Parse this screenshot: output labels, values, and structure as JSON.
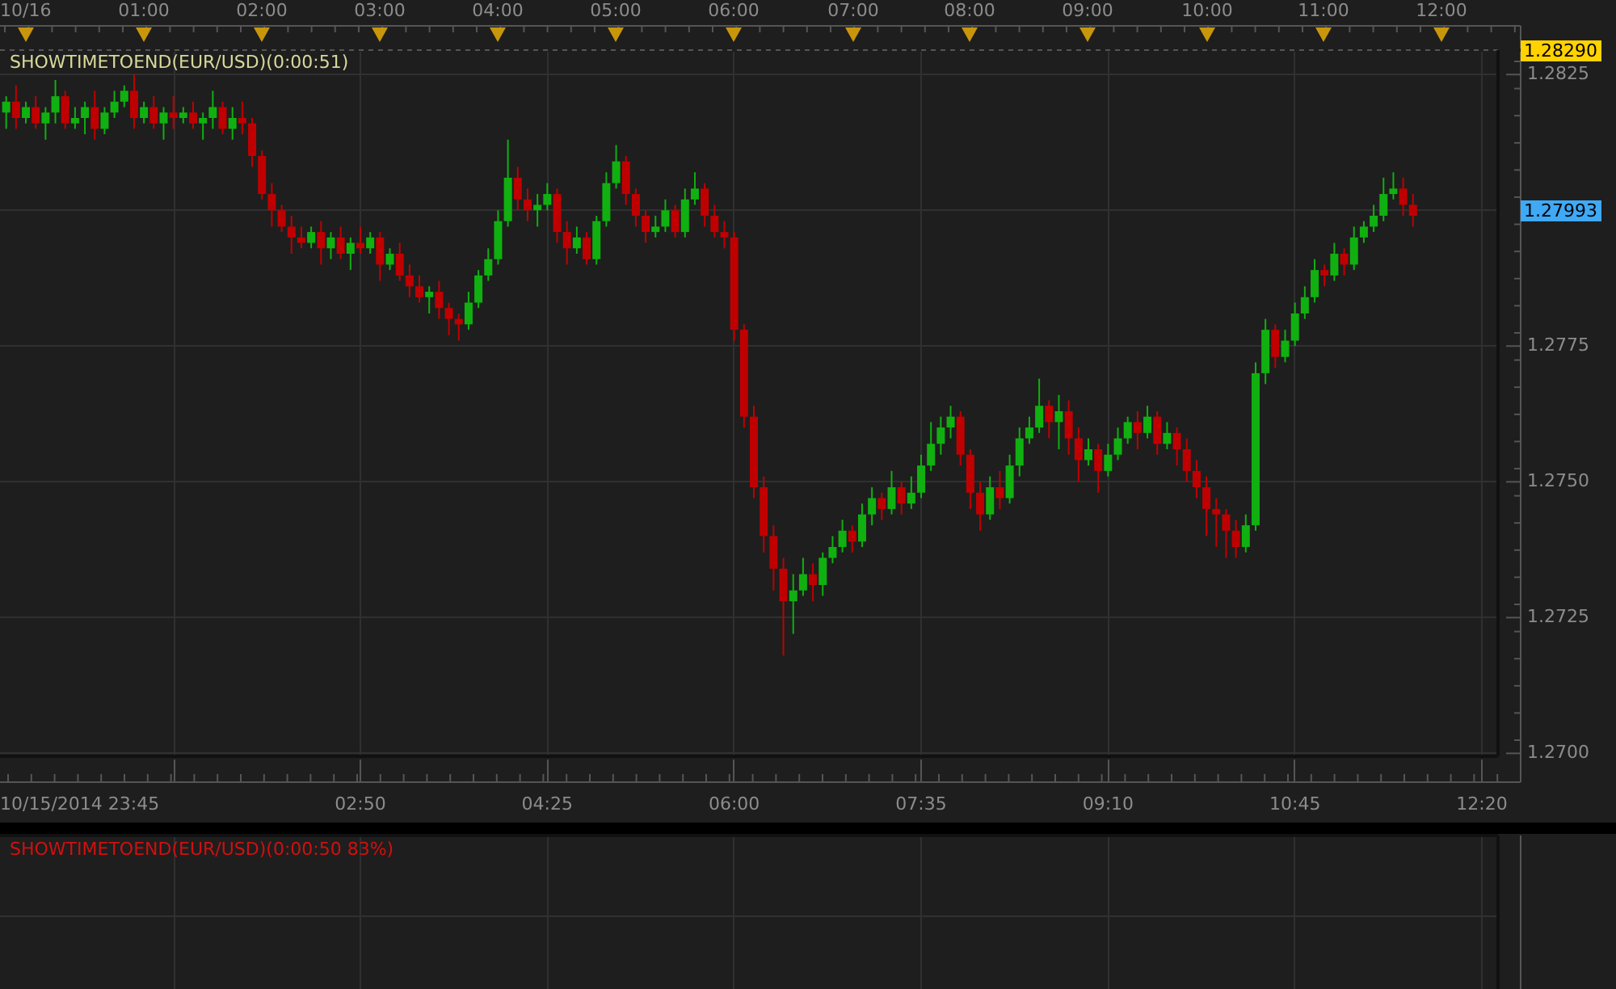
{
  "top_axis": {
    "labels": [
      "10/16",
      "01:00",
      "02:00",
      "03:00",
      "04:00",
      "05:00",
      "06:00",
      "07:00",
      "08:00",
      "09:00",
      "10:00",
      "11:00",
      "12:00"
    ]
  },
  "main_panel": {
    "indicator_label": "SHOWTIMETOEND(EUR/USD)(0:00:51)",
    "chart_data": {
      "type": "candlestick",
      "ylim": [
        1.26947,
        1.28292
      ],
      "xlim": [
        -13.15,
        759.7
      ],
      "xticks": [
        {
          "value": 170,
          "label": "02:50"
        },
        {
          "value": 265,
          "label": "04:25"
        },
        {
          "value": 360,
          "label": "06:00"
        },
        {
          "value": 455,
          "label": "07:35"
        },
        {
          "value": 550,
          "label": "09:10"
        },
        {
          "value": 645,
          "label": "10:45"
        },
        {
          "value": 740,
          "label": "12:20"
        }
      ],
      "yticks": [
        {
          "value": 1.2825,
          "label": "1.2825"
        },
        {
          "value": 1.2775,
          "label": "1.2775"
        },
        {
          "value": 1.275,
          "label": "1.2750"
        },
        {
          "value": 1.2725,
          "label": "1.2725"
        },
        {
          "value": 1.27,
          "label": "1.2700"
        }
      ],
      "x": [
        -10,
        -5,
        0,
        5,
        10,
        15,
        20,
        25,
        30,
        35,
        40,
        45,
        50,
        55,
        60,
        65,
        70,
        75,
        80,
        85,
        90,
        95,
        100,
        105,
        110,
        115,
        120,
        125,
        130,
        135,
        140,
        145,
        150,
        155,
        160,
        165,
        170,
        175,
        180,
        185,
        190,
        195,
        200,
        205,
        210,
        215,
        220,
        225,
        230,
        235,
        240,
        245,
        250,
        255,
        260,
        265,
        270,
        275,
        280,
        285,
        290,
        295,
        300,
        305,
        310,
        315,
        320,
        325,
        330,
        335,
        340,
        345,
        350,
        355,
        360,
        365,
        370,
        375,
        380,
        385,
        390,
        395,
        400,
        405,
        410,
        415,
        420,
        425,
        430,
        435,
        440,
        445,
        450,
        455,
        460,
        465,
        470,
        475,
        480,
        485,
        490,
        495,
        500,
        505,
        510,
        515,
        520,
        525,
        530,
        535,
        540,
        545,
        550,
        555,
        560,
        565,
        570,
        575,
        580,
        585,
        590,
        595,
        600,
        605,
        610,
        615,
        620,
        625,
        630,
        635,
        640,
        645,
        650,
        655,
        660,
        665,
        670,
        675,
        680,
        685,
        690,
        695,
        700,
        705
      ],
      "ohlc": [
        [
          1.2818,
          1.2821,
          1.2815,
          1.282
        ],
        [
          1.282,
          1.2823,
          1.2815,
          1.2817
        ],
        [
          1.2817,
          1.282,
          1.2816,
          1.2819
        ],
        [
          1.2819,
          1.2821,
          1.2815,
          1.2816
        ],
        [
          1.2816,
          1.2819,
          1.2813,
          1.2818
        ],
        [
          1.2818,
          1.2824,
          1.2816,
          1.2821
        ],
        [
          1.2821,
          1.2822,
          1.2815,
          1.2816
        ],
        [
          1.2816,
          1.2819,
          1.2815,
          1.2817
        ],
        [
          1.2817,
          1.282,
          1.2814,
          1.2819
        ],
        [
          1.2819,
          1.2822,
          1.2813,
          1.2815
        ],
        [
          1.2815,
          1.2819,
          1.2814,
          1.2818
        ],
        [
          1.2818,
          1.2822,
          1.2817,
          1.282
        ],
        [
          1.282,
          1.2823,
          1.2819,
          1.2822
        ],
        [
          1.2822,
          1.2825,
          1.2815,
          1.2817
        ],
        [
          1.2817,
          1.282,
          1.2816,
          1.2819
        ],
        [
          1.2819,
          1.2821,
          1.2815,
          1.2816
        ],
        [
          1.2816,
          1.2819,
          1.2813,
          1.2818
        ],
        [
          1.2818,
          1.2821,
          1.2815,
          1.2817
        ],
        [
          1.2817,
          1.2819,
          1.2816,
          1.2818
        ],
        [
          1.2818,
          1.282,
          1.2815,
          1.2816
        ],
        [
          1.2816,
          1.2818,
          1.2813,
          1.2817
        ],
        [
          1.2817,
          1.2822,
          1.2815,
          1.2819
        ],
        [
          1.2819,
          1.282,
          1.2814,
          1.2815
        ],
        [
          1.2815,
          1.2819,
          1.2813,
          1.2817
        ],
        [
          1.2817,
          1.282,
          1.2814,
          1.2816
        ],
        [
          1.2816,
          1.2817,
          1.2808,
          1.281
        ],
        [
          1.281,
          1.2811,
          1.2802,
          1.2803
        ],
        [
          1.2803,
          1.2805,
          1.2797,
          1.28
        ],
        [
          1.28,
          1.2801,
          1.2796,
          1.2797
        ],
        [
          1.2797,
          1.2799,
          1.2792,
          1.2795
        ],
        [
          1.2795,
          1.2797,
          1.2793,
          1.2794
        ],
        [
          1.2794,
          1.2797,
          1.2793,
          1.2796
        ],
        [
          1.2796,
          1.2798,
          1.279,
          1.2793
        ],
        [
          1.2793,
          1.2796,
          1.2791,
          1.2795
        ],
        [
          1.2795,
          1.2797,
          1.2791,
          1.2792
        ],
        [
          1.2792,
          1.2795,
          1.2789,
          1.2794
        ],
        [
          1.2794,
          1.2797,
          1.2792,
          1.2793
        ],
        [
          1.2793,
          1.2796,
          1.2792,
          1.2795
        ],
        [
          1.2795,
          1.2796,
          1.2787,
          1.279
        ],
        [
          1.279,
          1.2793,
          1.2789,
          1.2792
        ],
        [
          1.2792,
          1.2794,
          1.2787,
          1.2788
        ],
        [
          1.2788,
          1.279,
          1.2784,
          1.2786
        ],
        [
          1.2786,
          1.2788,
          1.2783,
          1.2784
        ],
        [
          1.2784,
          1.2786,
          1.2781,
          1.2785
        ],
        [
          1.2785,
          1.2787,
          1.278,
          1.2782
        ],
        [
          1.2782,
          1.2783,
          1.2777,
          1.278
        ],
        [
          1.278,
          1.2781,
          1.2776,
          1.2779
        ],
        [
          1.2779,
          1.2785,
          1.2778,
          1.2783
        ],
        [
          1.2783,
          1.2789,
          1.2782,
          1.2788
        ],
        [
          1.2788,
          1.2793,
          1.2787,
          1.2791
        ],
        [
          1.2791,
          1.28,
          1.279,
          1.2798
        ],
        [
          1.2798,
          1.2813,
          1.2797,
          1.2806
        ],
        [
          1.2806,
          1.2808,
          1.28,
          1.2802
        ],
        [
          1.2802,
          1.2804,
          1.2798,
          1.28
        ],
        [
          1.28,
          1.2803,
          1.2797,
          1.2801
        ],
        [
          1.2801,
          1.2805,
          1.28,
          1.2803
        ],
        [
          1.2803,
          1.2804,
          1.2794,
          1.2796
        ],
        [
          1.2796,
          1.2798,
          1.279,
          1.2793
        ],
        [
          1.2793,
          1.2797,
          1.2792,
          1.2795
        ],
        [
          1.2795,
          1.2796,
          1.279,
          1.2791
        ],
        [
          1.2791,
          1.2799,
          1.279,
          1.2798
        ],
        [
          1.2798,
          1.2807,
          1.2797,
          1.2805
        ],
        [
          1.2805,
          1.2812,
          1.2804,
          1.2809
        ],
        [
          1.2809,
          1.281,
          1.2801,
          1.2803
        ],
        [
          1.2803,
          1.2804,
          1.2797,
          1.2799
        ],
        [
          1.2799,
          1.28,
          1.2794,
          1.2796
        ],
        [
          1.2796,
          1.2799,
          1.2795,
          1.2797
        ],
        [
          1.2797,
          1.2802,
          1.2796,
          1.28
        ],
        [
          1.28,
          1.2801,
          1.2795,
          1.2796
        ],
        [
          1.2796,
          1.2804,
          1.2795,
          1.2802
        ],
        [
          1.2802,
          1.2807,
          1.2801,
          1.2804
        ],
        [
          1.2804,
          1.2805,
          1.2797,
          1.2799
        ],
        [
          1.2799,
          1.2801,
          1.2795,
          1.2796
        ],
        [
          1.2796,
          1.2798,
          1.2793,
          1.2795
        ],
        [
          1.2795,
          1.2796,
          1.2776,
          1.2778
        ],
        [
          1.2778,
          1.2779,
          1.276,
          1.2762
        ],
        [
          1.2762,
          1.2764,
          1.2747,
          1.2749
        ],
        [
          1.2749,
          1.2751,
          1.2737,
          1.274
        ],
        [
          1.274,
          1.2742,
          1.273,
          1.2734
        ],
        [
          1.2734,
          1.2736,
          1.2718,
          1.2728
        ],
        [
          1.2728,
          1.2733,
          1.2722,
          1.273
        ],
        [
          1.273,
          1.2736,
          1.2729,
          1.2733
        ],
        [
          1.2733,
          1.2735,
          1.2728,
          1.2731
        ],
        [
          1.2731,
          1.2737,
          1.2729,
          1.2736
        ],
        [
          1.2736,
          1.274,
          1.2735,
          1.2738
        ],
        [
          1.2738,
          1.2743,
          1.2737,
          1.2741
        ],
        [
          1.2741,
          1.2742,
          1.2737,
          1.2739
        ],
        [
          1.2739,
          1.2746,
          1.2738,
          1.2744
        ],
        [
          1.2744,
          1.2749,
          1.2742,
          1.2747
        ],
        [
          1.2747,
          1.2748,
          1.2743,
          1.2745
        ],
        [
          1.2745,
          1.2752,
          1.2744,
          1.2749
        ],
        [
          1.2749,
          1.275,
          1.2744,
          1.2746
        ],
        [
          1.2746,
          1.2751,
          1.2745,
          1.2748
        ],
        [
          1.2748,
          1.2755,
          1.2747,
          1.2753
        ],
        [
          1.2753,
          1.2761,
          1.2752,
          1.2757
        ],
        [
          1.2757,
          1.2762,
          1.2755,
          1.276
        ],
        [
          1.276,
          1.2764,
          1.2758,
          1.2762
        ],
        [
          1.2762,
          1.2763,
          1.2753,
          1.2755
        ],
        [
          1.2755,
          1.2756,
          1.2745,
          1.2748
        ],
        [
          1.2748,
          1.275,
          1.2741,
          1.2744
        ],
        [
          1.2744,
          1.2751,
          1.2743,
          1.2749
        ],
        [
          1.2749,
          1.2752,
          1.2745,
          1.2747
        ],
        [
          1.2747,
          1.2755,
          1.2746,
          1.2753
        ],
        [
          1.2753,
          1.276,
          1.2751,
          1.2758
        ],
        [
          1.2758,
          1.2762,
          1.2757,
          1.276
        ],
        [
          1.276,
          1.2769,
          1.2759,
          1.2764
        ],
        [
          1.2764,
          1.2765,
          1.2758,
          1.2761
        ],
        [
          1.2761,
          1.2766,
          1.2756,
          1.2763
        ],
        [
          1.2763,
          1.2765,
          1.2755,
          1.2758
        ],
        [
          1.2758,
          1.276,
          1.275,
          1.2754
        ],
        [
          1.2754,
          1.2758,
          1.2753,
          1.2756
        ],
        [
          1.2756,
          1.2757,
          1.2748,
          1.2752
        ],
        [
          1.2752,
          1.2757,
          1.2751,
          1.2755
        ],
        [
          1.2755,
          1.276,
          1.2754,
          1.2758
        ],
        [
          1.2758,
          1.2762,
          1.2757,
          1.2761
        ],
        [
          1.2761,
          1.2763,
          1.2756,
          1.2759
        ],
        [
          1.2759,
          1.2764,
          1.2758,
          1.2762
        ],
        [
          1.2762,
          1.2763,
          1.2755,
          1.2757
        ],
        [
          1.2757,
          1.2761,
          1.2756,
          1.2759
        ],
        [
          1.2759,
          1.276,
          1.2753,
          1.2756
        ],
        [
          1.2756,
          1.2758,
          1.275,
          1.2752
        ],
        [
          1.2752,
          1.2754,
          1.2747,
          1.2749
        ],
        [
          1.2749,
          1.2751,
          1.274,
          1.2745
        ],
        [
          1.2745,
          1.2747,
          1.2738,
          1.2744
        ],
        [
          1.2744,
          1.2745,
          1.2736,
          1.2741
        ],
        [
          1.2741,
          1.2743,
          1.2736,
          1.2738
        ],
        [
          1.2738,
          1.2744,
          1.2737,
          1.2742
        ],
        [
          1.2742,
          1.2772,
          1.2741,
          1.277
        ],
        [
          1.277,
          1.278,
          1.2768,
          1.2778
        ],
        [
          1.2778,
          1.2779,
          1.2771,
          1.2773
        ],
        [
          1.2773,
          1.2778,
          1.2772,
          1.2776
        ],
        [
          1.2776,
          1.2783,
          1.2775,
          1.2781
        ],
        [
          1.2781,
          1.2786,
          1.278,
          1.2784
        ],
        [
          1.2784,
          1.2791,
          1.2783,
          1.2789
        ],
        [
          1.2789,
          1.279,
          1.2786,
          1.2788
        ],
        [
          1.2788,
          1.2794,
          1.2787,
          1.2792
        ],
        [
          1.2792,
          1.2793,
          1.2788,
          1.279
        ],
        [
          1.279,
          1.2797,
          1.2789,
          1.2795
        ],
        [
          1.2795,
          1.2798,
          1.2794,
          1.2797
        ],
        [
          1.2797,
          1.2801,
          1.2796,
          1.2799
        ],
        [
          1.2799,
          1.2806,
          1.2798,
          1.2803
        ],
        [
          1.2803,
          1.2807,
          1.2802,
          1.2804
        ],
        [
          1.2804,
          1.2806,
          1.2799,
          1.2801
        ],
        [
          1.2801,
          1.2803,
          1.2797,
          1.2799
        ]
      ]
    }
  },
  "price_axis": {
    "high_price": "1.28290",
    "last_price": "1.27993"
  },
  "bottom_axis": {
    "start_label": "10/15/2014 23:45"
  },
  "lower_panel": {
    "indicator_label": "SHOWTIMETOEND(EUR/USD)(0:00:50 83%)"
  }
}
